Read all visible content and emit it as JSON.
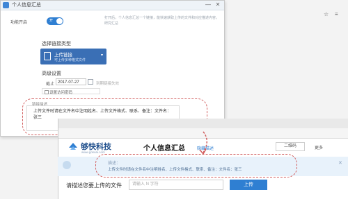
{
  "dialog": {
    "title": "个人信息汇总",
    "win_minimize": "—",
    "win_close": "✕",
    "toggle_label": "功能开启",
    "toggle_text": "开",
    "toggle_on": true,
    "hint": "打开后，个人信息汇总一个链接，能快速获取上传的文件和对应描述内容，研究汇总",
    "upload_section": "选择链接类型",
    "upload_button": {
      "line1": "上传链接",
      "line2": "可上传多种格式文件"
    },
    "advanced_section": "高级设置",
    "date_label": "截止",
    "date_value": "2017-07-27",
    "date_hint": "到期链接失效",
    "checkbox_label": "设置访问密码",
    "desc_label": "链接描述",
    "desc_text": "上传文件时请在文件名中注明姓名、上传文件格式、联系、备注：文件名：张三"
  },
  "browser": {
    "logo_name": "够快科技",
    "logo_url": "www.gokuai.com",
    "page_heading": "个人信息汇总",
    "prefs_link": "隐藏描述",
    "qr_button": "二维码",
    "menu_button": "更多",
    "info_label": "描述：",
    "info_text": "上传文件时请在文件名中注明姓名、上传文件格式、联系、备注：文件名：张三",
    "info_close": "✕",
    "faded_left": "",
    "search_label": "请描述您要上传的文件",
    "search_placeholder": "请输入 N 字符",
    "search_button": "上传"
  },
  "colors": {
    "accent": "#2f7fd2",
    "annotation": "#d15c5c",
    "info_bg": "#e8f2fb"
  }
}
